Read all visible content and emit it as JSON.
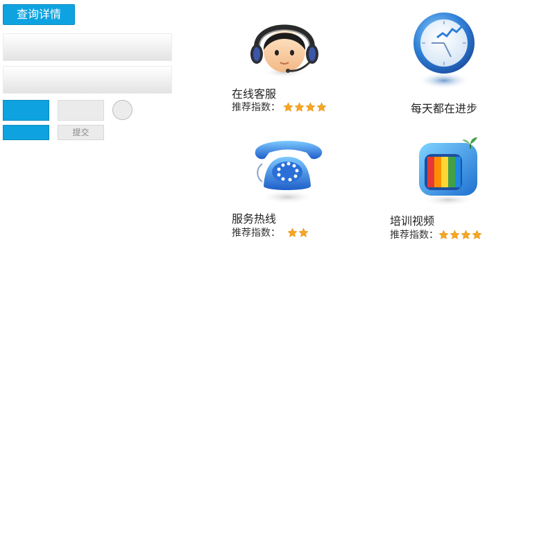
{
  "buttons": {
    "query_label": "查询详情",
    "submit_label": "提交"
  },
  "tiles": [
    {
      "title": "在线客服",
      "rating_label": "推荐指数：",
      "stars": 4,
      "icon": "headset-agent-icon"
    },
    {
      "title": "每天都在进步",
      "icon": "clock-chart-icon"
    },
    {
      "title": "服务热线",
      "rating_label": "推荐指数：",
      "stars": 2,
      "icon": "telephone-icon"
    },
    {
      "title": "培训视频",
      "rating_label": "推荐指数：",
      "stars": 4,
      "icon": "tv-icon"
    }
  ],
  "colors": {
    "accent": "#0ea3e0",
    "star": "#f5a623"
  }
}
